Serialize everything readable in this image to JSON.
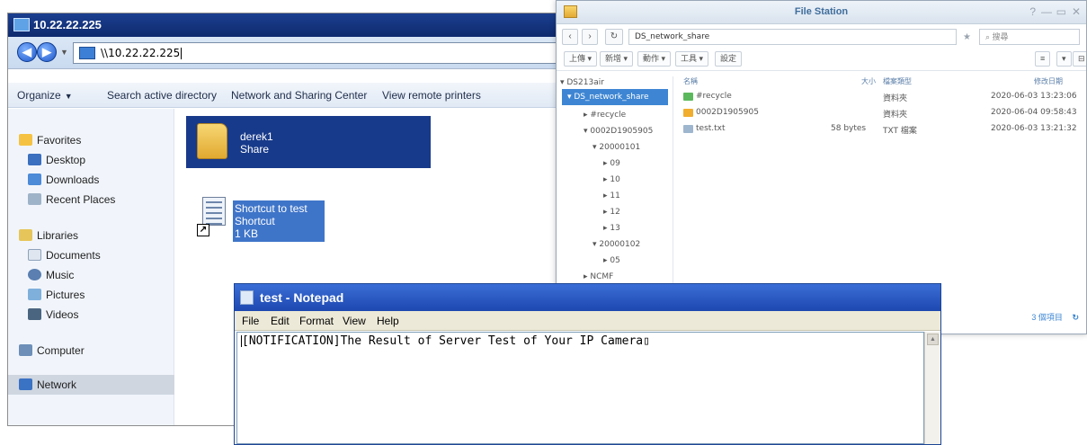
{
  "explorer": {
    "title": "10.22.22.225",
    "address": "\\\\10.22.22.225",
    "commands": {
      "organize": "Organize",
      "search_ad": "Search active directory",
      "network_sharing": "Network and Sharing Center",
      "view_printers": "View remote printers"
    },
    "nav": {
      "favorites": "Favorites",
      "desktop": "Desktop",
      "downloads": "Downloads",
      "recent_places": "Recent Places",
      "libraries": "Libraries",
      "documents": "Documents",
      "music": "Music",
      "pictures": "Pictures",
      "videos": "Videos",
      "computer": "Computer",
      "network": "Network"
    },
    "items": [
      {
        "name": "derek1",
        "type": "Share"
      },
      {
        "name": "Shortcut to test",
        "type": "Shortcut",
        "size": "1 KB"
      }
    ]
  },
  "filestation": {
    "title": "File Station",
    "path": "DS_network_share",
    "search_placeholder": "搜尋",
    "toolbar": [
      "上傳 ▾",
      "新增 ▾",
      "動作 ▾",
      "工具 ▾",
      "設定"
    ],
    "tree": [
      {
        "label": "▾ DS213air",
        "depth": 0
      },
      {
        "label": "▾ DS_network_share",
        "depth": 1,
        "selected": true
      },
      {
        "label": "▸ #recycle",
        "depth": 2
      },
      {
        "label": "▾ 0002D1905905",
        "depth": 2
      },
      {
        "label": "▾ 20000101",
        "depth": 3
      },
      {
        "label": "▸ 09",
        "depth": 4
      },
      {
        "label": "▸ 10",
        "depth": 4
      },
      {
        "label": "▸ 11",
        "depth": 4
      },
      {
        "label": "▸ 12",
        "depth": 4
      },
      {
        "label": "▸ 13",
        "depth": 4
      },
      {
        "label": "▾ 20000102",
        "depth": 3
      },
      {
        "label": "▸ 05",
        "depth": 4
      },
      {
        "label": "▸ NCMF",
        "depth": 2
      }
    ],
    "columns": {
      "name": "名稱",
      "size": "大小",
      "type": "檔案類型",
      "modified": "修改日期"
    },
    "files": [
      {
        "name": "#recycle",
        "size": "",
        "type": "資料夾",
        "modified": "2020-06-03 13:23:06",
        "icon_color": "#5cb85c"
      },
      {
        "name": "0002D1905905",
        "size": "",
        "type": "資料夾",
        "modified": "2020-06-04 09:58:43",
        "icon_color": "#f0ad2e"
      },
      {
        "name": "test.txt",
        "size": "58 bytes",
        "type": "TXT 檔案",
        "modified": "2020-06-03 13:21:32",
        "icon_color": "#9fb6cf"
      }
    ],
    "footer": "3 個項目"
  },
  "notepad": {
    "title": "test - Notepad",
    "menus": [
      "File",
      "Edit",
      "Format",
      "View",
      "Help"
    ],
    "content": "[NOTIFICATION]The Result of Server Test of Your IP Camera"
  }
}
